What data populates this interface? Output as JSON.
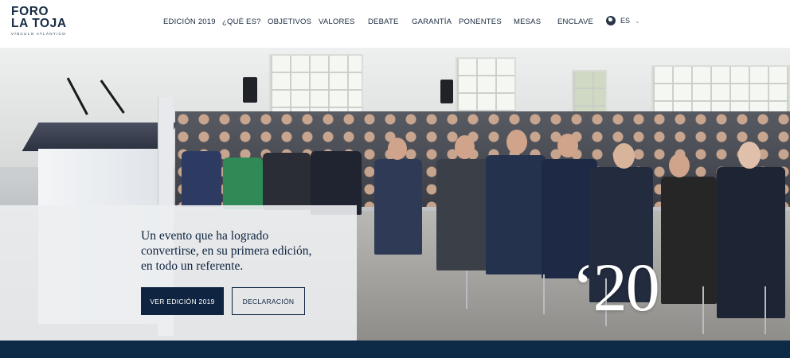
{
  "logo": {
    "line1": "FORO",
    "line2": "LA TOJA",
    "line3": "VÍNCULO ATLÁNTICO"
  },
  "nav": {
    "items": [
      {
        "label": "EDICIÓN 2019"
      },
      {
        "label": "¿QUÉ ES?"
      },
      {
        "label": "OBJETIVOS"
      },
      {
        "label": "VALORES"
      },
      {
        "label": "DEBATE"
      },
      {
        "label": "GARANTÍA"
      },
      {
        "label": "PONENTES"
      },
      {
        "label": "MESAS"
      },
      {
        "label": "ENCLAVE"
      }
    ],
    "language": "ES",
    "language_icon": "globe-icon"
  },
  "hero": {
    "tagline_line1": "Un evento que ha logrado",
    "tagline_line2": "convertirse, en su primera edición,",
    "tagline_line3": "en todo un referente.",
    "primary_button": "VER EDICIÓN 2019",
    "secondary_button": "DECLARACIÓN",
    "year_mark": "‘20"
  },
  "colors": {
    "brand_navy": "#0f2440",
    "footer_band": "#0d2a46",
    "panel_bg": "#eceef1"
  }
}
